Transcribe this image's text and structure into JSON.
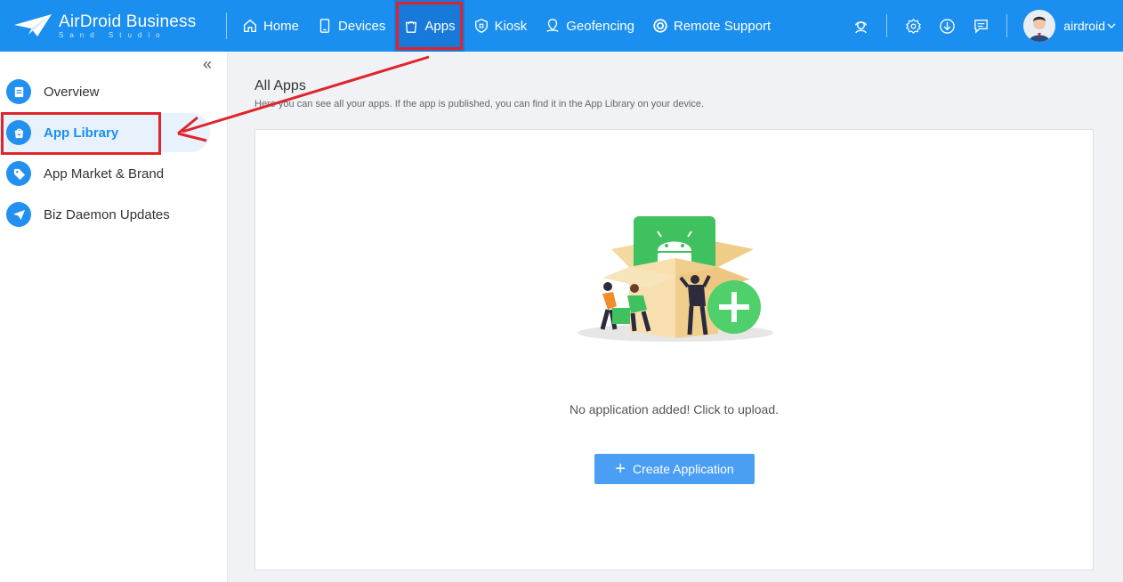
{
  "brand": {
    "title": "AirDroid Business",
    "subtitle": "Sand Studio"
  },
  "nav": [
    {
      "label": "Home",
      "icon": "home-icon"
    },
    {
      "label": "Devices",
      "icon": "device-icon"
    },
    {
      "label": "Apps",
      "icon": "bag-icon"
    },
    {
      "label": "Kiosk",
      "icon": "lock-icon"
    },
    {
      "label": "Geofencing",
      "icon": "map-pin-icon"
    },
    {
      "label": "Remote Support",
      "icon": "lifebuoy-icon"
    }
  ],
  "header_icons": [
    "support-agent-icon",
    "gear-icon",
    "download-icon",
    "message-icon"
  ],
  "user": {
    "name": "airdroid"
  },
  "sidebar": {
    "items": [
      {
        "label": "Overview",
        "icon": "document-icon"
      },
      {
        "label": "App Library",
        "icon": "bag-icon"
      },
      {
        "label": "App Market & Brand",
        "icon": "tag-icon"
      },
      {
        "label": "Biz Daemon Updates",
        "icon": "paper-plane-icon"
      }
    ]
  },
  "main": {
    "title": "All Apps",
    "subtitle": "Here you can see all your apps. If the app is published, you can find it in the App Library on your device.",
    "empty_text": "No application added! Click to upload.",
    "create_button": "Create Application"
  },
  "colors": {
    "primary": "#1a8ff0",
    "highlight": "#e0242b",
    "android_green": "#3ec15e",
    "button": "#4a9ff5"
  }
}
